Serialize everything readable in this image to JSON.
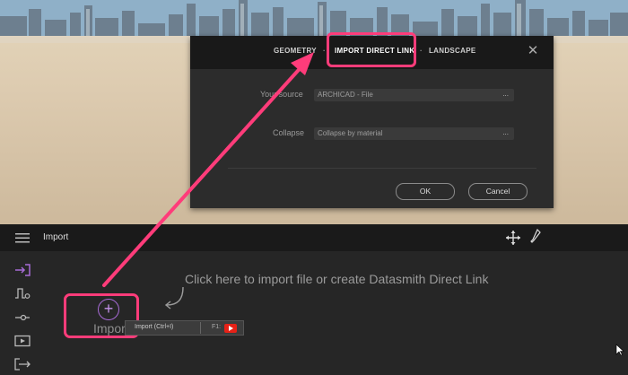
{
  "dialog": {
    "tabs": [
      {
        "label": "GEOMETRY"
      },
      {
        "label": "IMPORT DIRECT LINK"
      },
      {
        "label": "LANDSCAPE"
      }
    ],
    "separator": "·",
    "close": "✕",
    "source_label": "Your source",
    "source_value": "ARCHICAD - File",
    "collapse_label": "Collapse",
    "collapse_value": "Collapse by material",
    "dots": "...",
    "ok_label": "OK",
    "cancel_label": "Cancel"
  },
  "toolbar": {
    "title": "Import"
  },
  "main": {
    "hint": "Click here to import file or create Datasmith Direct Link",
    "import_label": "Import",
    "tooltip_label": "Import (Ctrl+I)",
    "tooltip_key": "F1:"
  },
  "colors": {
    "highlight": "#ff3c7a",
    "accent": "#a76bd6"
  },
  "icons": [
    "hamburger-icon",
    "move-icon",
    "eyedropper-icon",
    "import-icon",
    "waveform-icon",
    "slider-icon",
    "video-icon",
    "export-icon",
    "plus-circle-icon",
    "curved-arrow-icon",
    "youtube-icon",
    "cursor-icon"
  ]
}
